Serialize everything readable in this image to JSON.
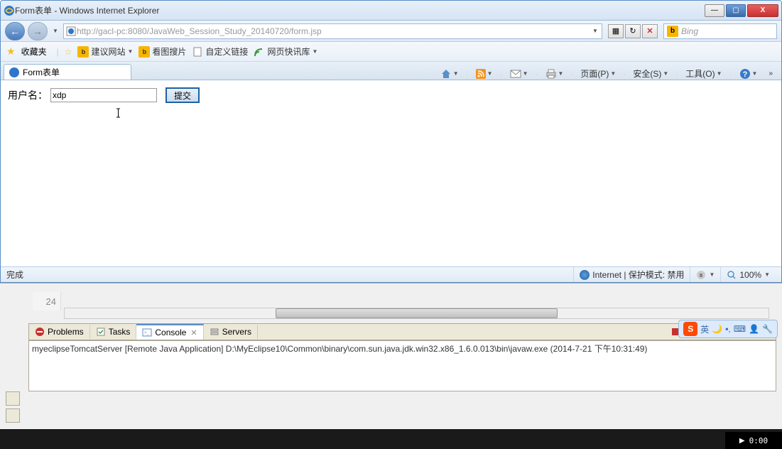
{
  "titlebar": {
    "text": "Form表单 - Windows Internet Explorer"
  },
  "navbar": {
    "url": "http://gacl-pc:8080/JavaWeb_Session_Study_20140720/form.jsp",
    "search_placeholder": "Bing"
  },
  "favbar": {
    "favorites_label": "收藏夹",
    "items": [
      {
        "label": "建议网站",
        "has_drop": true
      },
      {
        "label": "看图搜片"
      },
      {
        "label": "自定义链接"
      },
      {
        "label": "网页快讯库",
        "has_drop": true
      }
    ]
  },
  "tabbar": {
    "tab_label": "Form表单",
    "tools": [
      {
        "label": "页面(P)",
        "has_drop": true
      },
      {
        "label": "安全(S)",
        "has_drop": true
      },
      {
        "label": "工具(O)",
        "has_drop": true
      }
    ]
  },
  "form": {
    "username_label": "用户名：",
    "username_value": "xdp",
    "submit_label": "提交"
  },
  "statusbar": {
    "status_text": "完成",
    "zone_text": "Internet | 保护模式: 禁用",
    "zoom_text": "100%"
  },
  "ide": {
    "line_number": "24",
    "tabs": {
      "problems": "Problems",
      "tasks": "Tasks",
      "console": "Console",
      "servers": "Servers"
    },
    "console_text": "myeclipseTomcatServer [Remote Java Application] D:\\MyEclipse10\\Common\\binary\\com.sun.java.jdk.win32.x86_1.6.0.013\\bin\\javaw.exe (2014-7-21 下午10:31:49)"
  },
  "ime": {
    "lang": "英"
  },
  "taskbar": {
    "time": "0:00"
  }
}
